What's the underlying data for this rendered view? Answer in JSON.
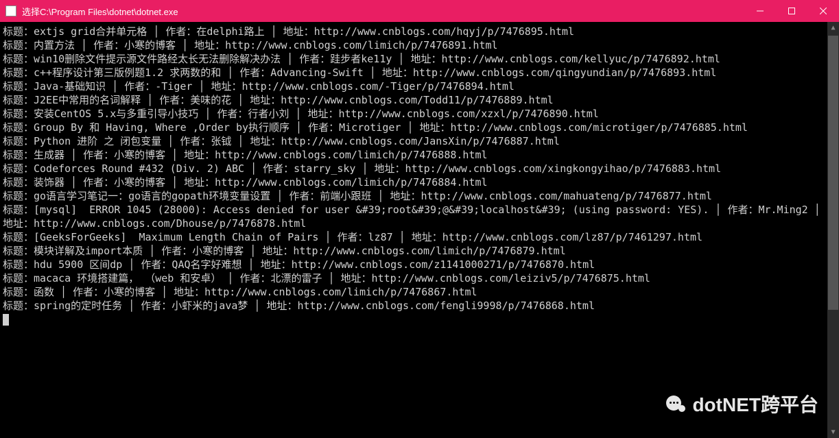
{
  "window": {
    "title": "选择C:\\Program Files\\dotnet\\dotnet.exe"
  },
  "labels": {
    "title_prefix": "标题：",
    "author_prefix": "作者：",
    "url_prefix": "地址：",
    "sep": " │ "
  },
  "entries": [
    {
      "title": "extjs grid合并单元格",
      "author": "在delphi路上",
      "url": "http://www.cnblogs.com/hqyj/p/7476895.html"
    },
    {
      "title": "内置方法",
      "author": "小寒的博客",
      "url": "http://www.cnblogs.com/limich/p/7476891.html"
    },
    {
      "title": "win10删除文件提示源文件路经太长无法删除解决办法",
      "author": "跬步者ke11y",
      "url": "http://www.cnblogs.com/kellyuc/p/7476892.html"
    },
    {
      "title": "c++程序设计第三版例题1.2 求两数的和",
      "author": "Advancing-Swift",
      "url": "http://www.cnblogs.com/qingyundian/p/7476893.html"
    },
    {
      "title": "Java-基础知识",
      "author": "-Tiger",
      "url": "http://www.cnblogs.com/-Tiger/p/7476894.html"
    },
    {
      "title": "J2EE中常用的名词解释",
      "author": "美味的花",
      "url": "http://www.cnblogs.com/Todd11/p/7476889.html"
    },
    {
      "title": "安装CentOS 5.x与多重引导小技巧",
      "author": "行者小刘",
      "url": "http://www.cnblogs.com/xzxl/p/7476890.html"
    },
    {
      "title": "Group By 和 Having, Where ,Order by执行顺序",
      "author": "Microtiger",
      "url": "http://www.cnblogs.com/microtiger/p/7476885.html"
    },
    {
      "title": "Python 进阶 之 闭包变量",
      "author": "张钺",
      "url": "http://www.cnblogs.com/JansXin/p/7476887.html"
    },
    {
      "title": "生成器",
      "author": "小寒的博客",
      "url": "http://www.cnblogs.com/limich/p/7476888.html"
    },
    {
      "title": "Codeforces Round #432 (Div. 2) ABC",
      "author": "starry_sky",
      "url": "http://www.cnblogs.com/xingkongyihao/p/7476883.html"
    },
    {
      "title": "装饰器",
      "author": "小寒的博客",
      "url": "http://www.cnblogs.com/limich/p/7476884.html"
    },
    {
      "title": "go语言学习笔记一：go语言的gopath环境变量设置",
      "author": "前端小跟班",
      "url": "http://www.cnblogs.com/mahuateng/p/7476877.html"
    },
    {
      "title": "[mysql]  ERROR 1045 (28000): Access denied for user &#39;root&#39;@&#39;localhost&#39; (using password: YES).",
      "author": "Mr.Ming2",
      "url": "http://www.cnblogs.com/Dhouse/p/7476878.html"
    },
    {
      "title": "[GeeksForGeeks]  Maximum Length Chain of Pairs",
      "author": "lz87",
      "url": "http://www.cnblogs.com/lz87/p/7461297.html"
    },
    {
      "title": "模块详解及import本质",
      "author": "小寒的博客",
      "url": "http://www.cnblogs.com/limich/p/7476879.html"
    },
    {
      "title": "hdu 5900 区间dp",
      "author": "QAQ名字好难想",
      "url": "http://www.cnblogs.com/z1141000271/p/7476870.html"
    },
    {
      "title": "macaca 环境搭建篇， （web 和安卓）",
      "author": "北漂的雷子",
      "url": "http://www.cnblogs.com/leiziv5/p/7476875.html"
    },
    {
      "title": "函数",
      "author": "小寒的博客",
      "url": "http://www.cnblogs.com/limich/p/7476867.html"
    },
    {
      "title": "spring的定时任务",
      "author": "小虾米的java梦",
      "url": "http://www.cnblogs.com/fengli9998/p/7476868.html"
    }
  ],
  "watermark": {
    "text": "dotNET跨平台"
  }
}
